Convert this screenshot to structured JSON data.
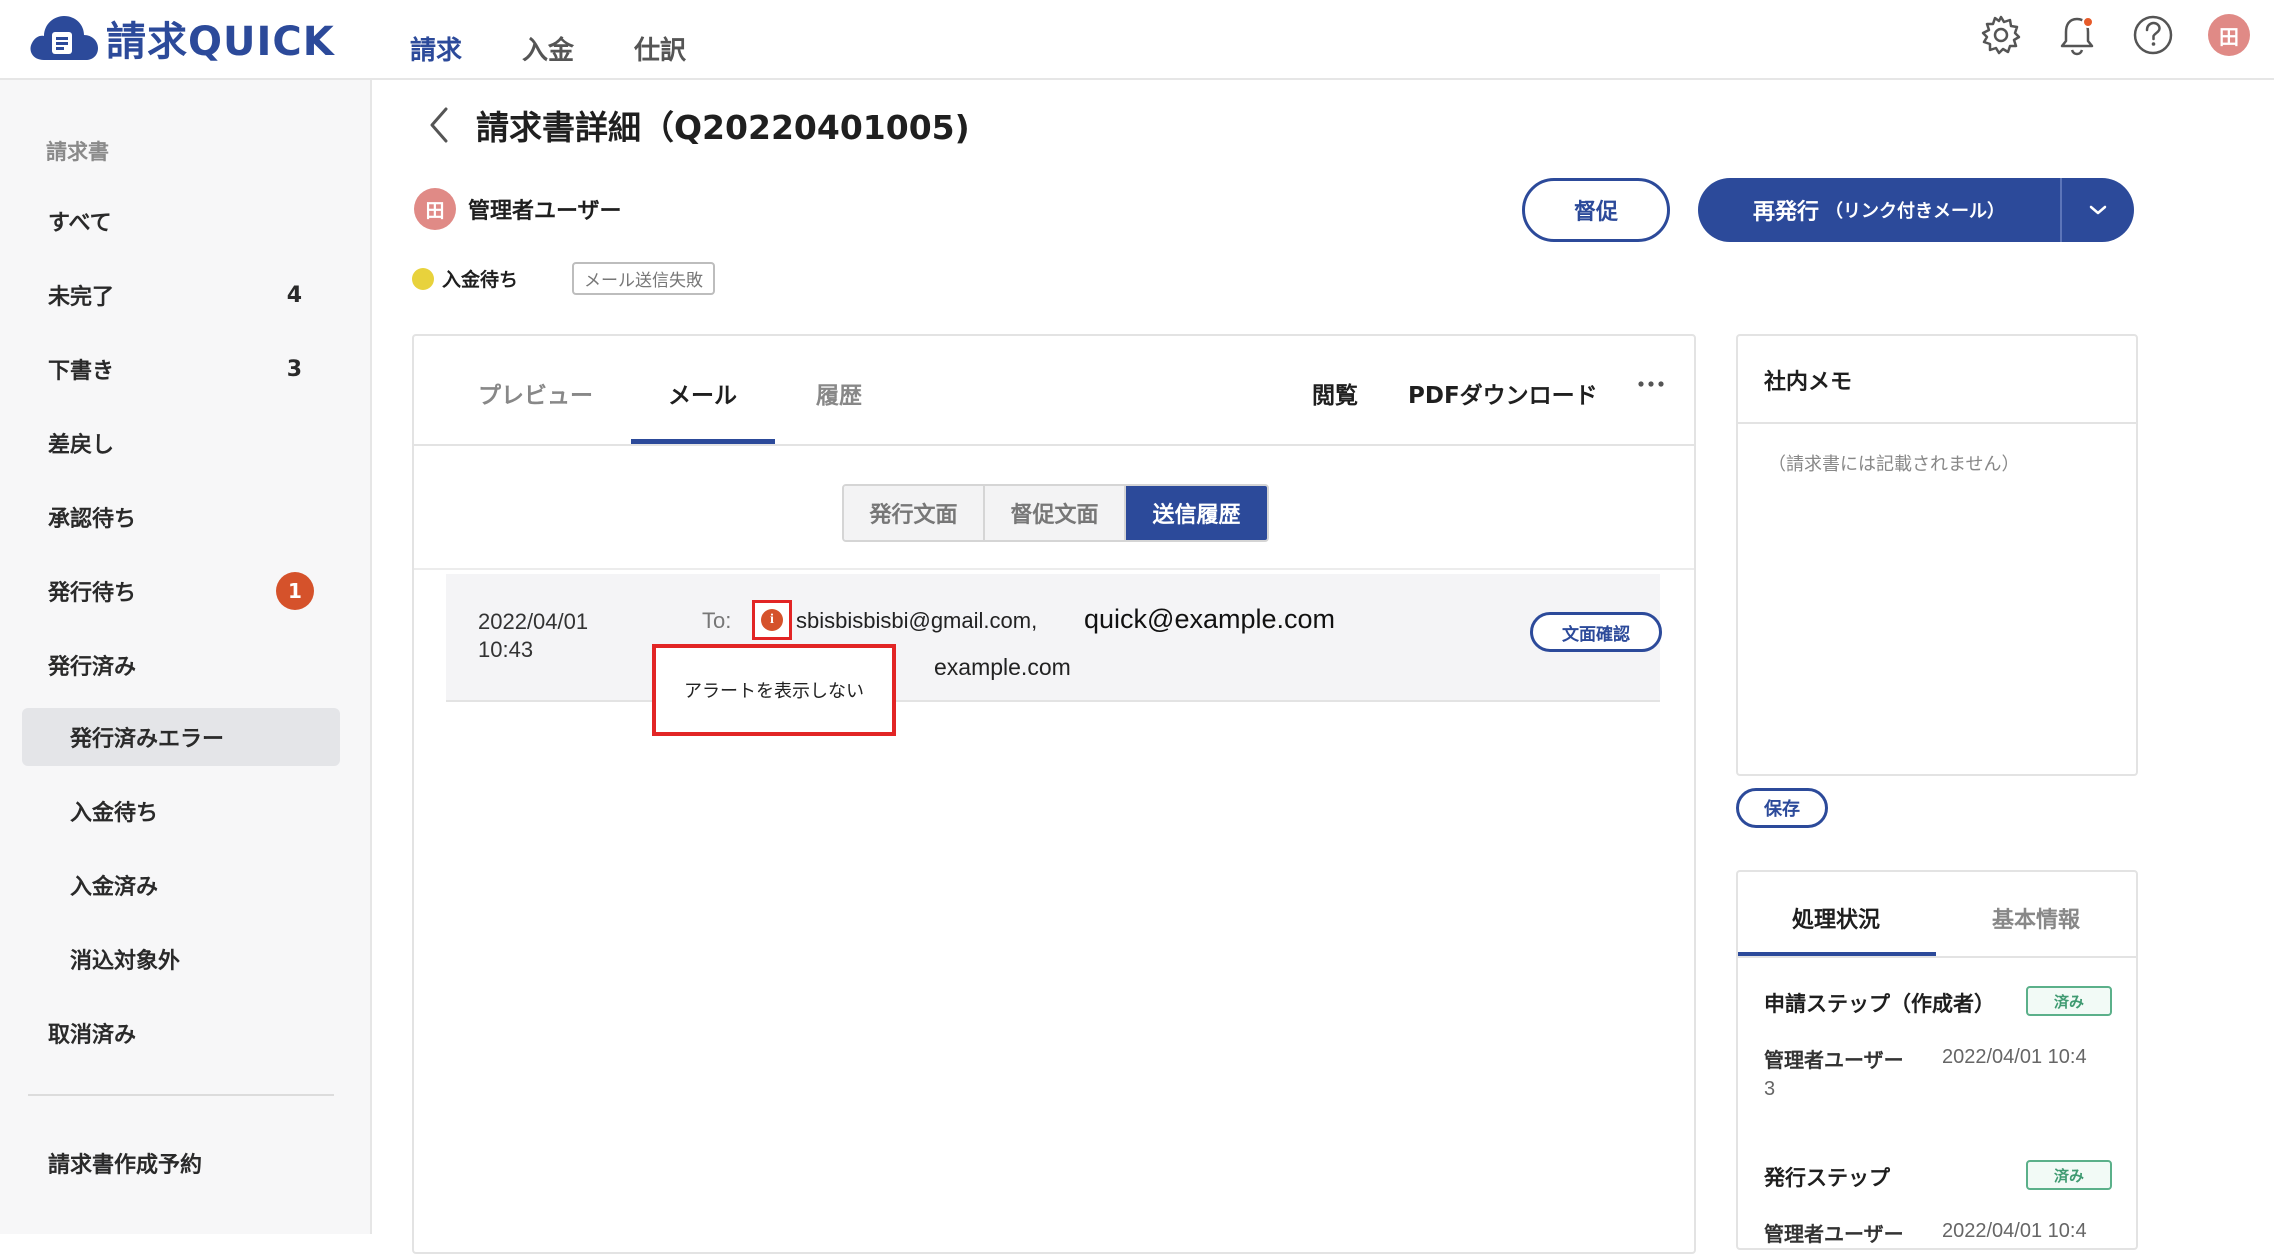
{
  "app": {
    "logo_text": "請求QUICK"
  },
  "topnav": [
    "請求",
    "入金",
    "仕訳"
  ],
  "user": {
    "avatar_initial": "田"
  },
  "sidebar": {
    "heading": "請求書",
    "items": [
      {
        "label": "すべて",
        "count": ""
      },
      {
        "label": "未完了",
        "count": "4"
      },
      {
        "label": "下書き",
        "count": "3"
      },
      {
        "label": "差戻し",
        "count": ""
      },
      {
        "label": "承認待ち",
        "count": ""
      },
      {
        "label": "発行待ち",
        "badge": "1"
      },
      {
        "label": "発行済み",
        "count": ""
      },
      {
        "label": "発行済みエラー",
        "count": ""
      },
      {
        "label": "入金待ち",
        "count": ""
      },
      {
        "label": "入金済み",
        "count": ""
      },
      {
        "label": "消込対象外",
        "count": ""
      },
      {
        "label": "取消済み",
        "count": ""
      }
    ],
    "footer_item": "請求書作成予約"
  },
  "page": {
    "title": "請求書詳細（Q20220401005)",
    "owner": "管理者ユーザー",
    "status": "入金待ち",
    "status_tag": "メール送信失敗",
    "status_color": "#e8d23c"
  },
  "actions": {
    "remind": "督促",
    "reissue": "再発行",
    "reissue_sub": "（リンク付きメール）"
  },
  "tabs": {
    "items": [
      "プレビュー",
      "メール",
      "履歴"
    ],
    "active": "メール",
    "view": "閲覧",
    "pdf": "PDFダウンロード"
  },
  "segments": {
    "items": [
      "発行文面",
      "督促文面",
      "送信履歴"
    ],
    "active": "送信履歴"
  },
  "history": {
    "date": "2022/04/01",
    "time": "10:43",
    "to_label": "To:",
    "email_1": "sbisbisbisbi@gmail.com",
    "email_2": "quick@example.com",
    "email_3": "example.com",
    "tooltip": "アラートを表示しない",
    "confirm": "文面確認"
  },
  "memo": {
    "title": "社内メモ",
    "placeholder": "（請求書には記載されません）",
    "save": "保存"
  },
  "process": {
    "tabs": [
      "処理状況",
      "基本情報"
    ],
    "steps": [
      {
        "title": "申請ステップ（作成者）",
        "status": "済み",
        "user": "管理者ユーザー",
        "time": "2022/04/01 10:4",
        "time_wrap": "3"
      },
      {
        "title": "発行ステップ",
        "status": "済み",
        "user": "管理者ユーザー",
        "time": "2022/04/01 10:4"
      }
    ]
  },
  "colors": {
    "brand": "#2c4a9a",
    "alert": "#e22525",
    "badge": "#d5522b",
    "done": "#3f9a71"
  }
}
